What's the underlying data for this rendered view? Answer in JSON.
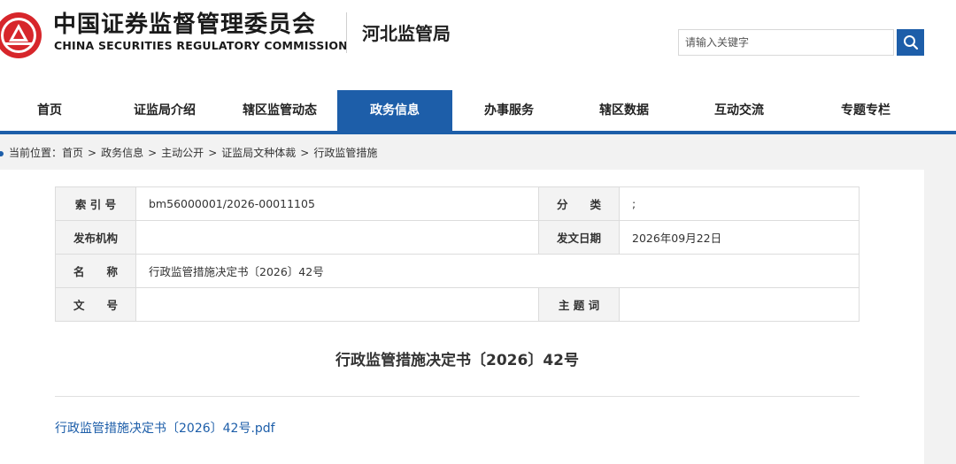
{
  "header": {
    "org_name_cn": "中国证券监督管理委员会",
    "org_name_en": "CHINA SECURITIES REGULATORY COMMISSION",
    "bureau_name": "河北监管局",
    "search": {
      "placeholder": "请输入关键字",
      "icon": "search-icon"
    },
    "logo_icon": "csrc-emblem-icon"
  },
  "nav": {
    "items": [
      {
        "label": "首页"
      },
      {
        "label": "证监局介绍"
      },
      {
        "label": "辖区监管动态"
      },
      {
        "label": "政务信息",
        "active": true
      },
      {
        "label": "办事服务"
      },
      {
        "label": "辖区数据"
      },
      {
        "label": "互动交流"
      },
      {
        "label": "专题专栏"
      }
    ]
  },
  "breadcrumb": {
    "prefix": "当前位置：",
    "items": [
      "首页",
      "政务信息",
      "主动公开",
      "证监局文种体裁",
      "行政监管措施"
    ],
    "separator": ">"
  },
  "meta": {
    "index_label": "索 引 号",
    "index_value": "bm56000001/2026-00011105",
    "category_label": "分　　类",
    "category_value": ";",
    "publisher_label": "发布机构",
    "publisher_value": "",
    "date_label": "发文日期",
    "date_value": "2026年09月22日",
    "name_label": "名　　称",
    "name_value": "行政监管措施决定书〔2026〕42号",
    "doc_no_label": "文　　号",
    "doc_no_value": "",
    "keywords_label": "主 题 词",
    "keywords_value": ""
  },
  "document": {
    "title": "行政监管措施决定书〔2026〕42号",
    "attachment": "行政监管措施决定书〔2026〕42号.pdf"
  },
  "colors": {
    "primary_blue": "#1d5ea9",
    "logo_red": "#d7262b",
    "link_blue": "#1d5ea9"
  }
}
